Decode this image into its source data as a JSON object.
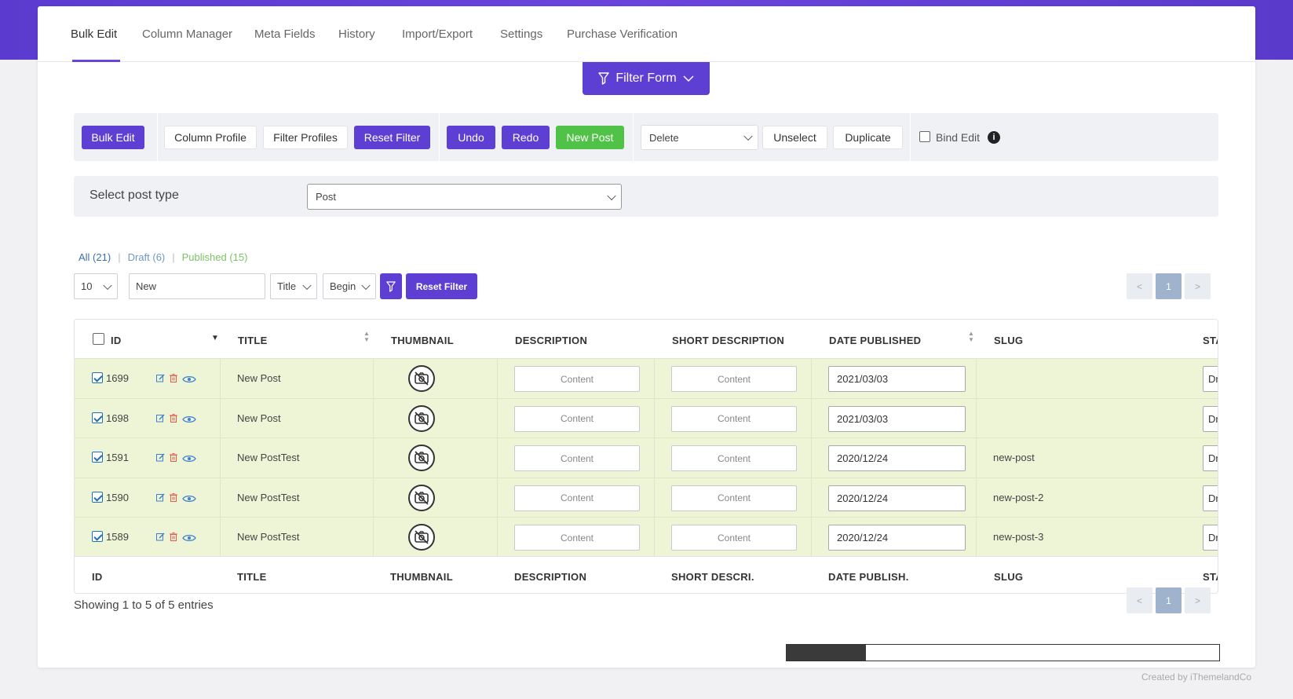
{
  "tabs": [
    {
      "label": "Bulk Edit",
      "active": true
    },
    {
      "label": "Column Manager"
    },
    {
      "label": "Meta Fields"
    },
    {
      "label": "History"
    },
    {
      "label": "Import/Export"
    },
    {
      "label": "Settings"
    },
    {
      "label": "Purchase Verification"
    }
  ],
  "filter_form_label": "Filter Form",
  "toolbar": {
    "bulk_edit": "Bulk Edit",
    "column_profile": "Column Profile",
    "filter_profiles": "Filter Profiles",
    "reset_filter": "Reset Filter",
    "undo": "Undo",
    "redo": "Redo",
    "new_post": "New Post",
    "action_select": "Delete",
    "unselect": "Unselect",
    "duplicate": "Duplicate",
    "bind_edit": "Bind Edit",
    "info_glyph": "i"
  },
  "post_type": {
    "label": "Select post type",
    "value": "Post"
  },
  "status_links": {
    "all": "All (21)",
    "draft": "Draft (6)",
    "published": "Published (15)"
  },
  "quick_filter": {
    "per_page": "10",
    "search_value": "New",
    "field": "Title",
    "operator": "Begin",
    "reset": "Reset Filter"
  },
  "pagination": {
    "prev": "<",
    "current": "1",
    "next": ">"
  },
  "columns": {
    "id": "ID",
    "title": "TITLE",
    "thumbnail": "THUMBNAIL",
    "description": "DESCRIPTION",
    "short_description": "SHORT DESCRIPTION",
    "date_published": "DATE PUBLISHED",
    "slug": "SLUG",
    "status": "STA"
  },
  "footer_columns": {
    "id": "ID",
    "title": "TITLE",
    "thumbnail": "THUMBNAIL",
    "description": "DESCRIPTION",
    "short_description": "SHORT DESCRI.",
    "date_published": "DATE PUBLISH.",
    "slug": "SLUG",
    "status": "STA"
  },
  "rows": [
    {
      "id": "1699",
      "title": "New Post",
      "description": "Content",
      "short_description": "Content",
      "date": "2021/03/03",
      "slug": "",
      "status": "Dr"
    },
    {
      "id": "1698",
      "title": "New Post",
      "description": "Content",
      "short_description": "Content",
      "date": "2021/03/03",
      "slug": "",
      "status": "Dr"
    },
    {
      "id": "1591",
      "title": "New PostTest",
      "description": "Content",
      "short_description": "Content",
      "date": "2020/12/24",
      "slug": "new-post",
      "status": "Dr"
    },
    {
      "id": "1590",
      "title": "New PostTest",
      "description": "Content",
      "short_description": "Content",
      "date": "2020/12/24",
      "slug": "new-post-2",
      "status": "Dr"
    },
    {
      "id": "1589",
      "title": "New PostTest",
      "description": "Content",
      "short_description": "Content",
      "date": "2020/12/24",
      "slug": "new-post-3",
      "status": "Dr"
    }
  ],
  "showing": "Showing 1 to 5 of 5 entries",
  "credit": "Created by iThemelandCo",
  "colors": {
    "accent": "#5d3fd3",
    "green": "#50c248",
    "row_bg": "#eef5d7"
  }
}
